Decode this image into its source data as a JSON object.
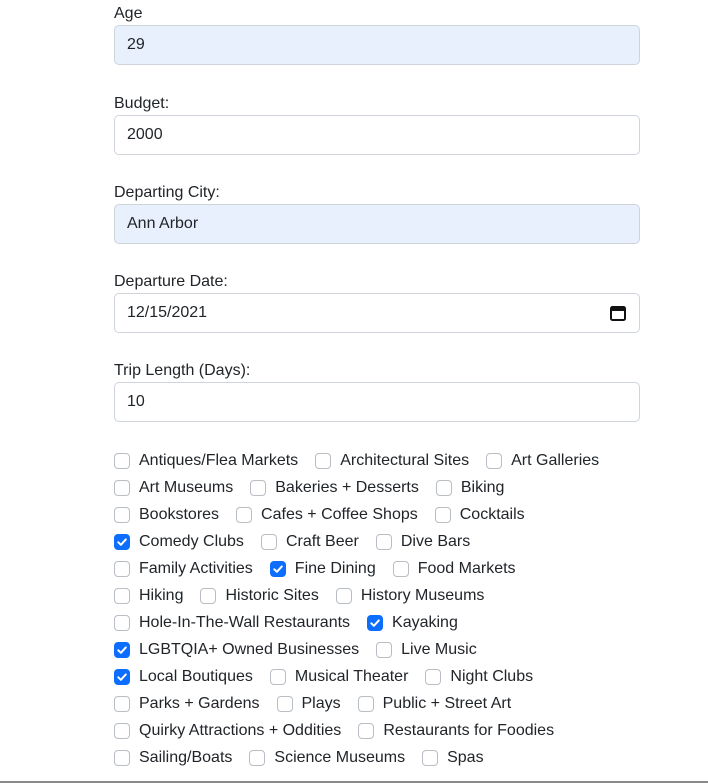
{
  "fields": {
    "age": {
      "label": "Age",
      "value": "29"
    },
    "budget": {
      "label": "Budget:",
      "value": "2000"
    },
    "departing_city": {
      "label": "Departing City:",
      "value": "Ann Arbor"
    },
    "departure_date": {
      "label": "Departure Date:",
      "value": "12/15/2021"
    },
    "trip_length": {
      "label": "Trip Length (Days):",
      "value": "10"
    }
  },
  "interests": {
    "rows": [
      [
        {
          "label": "Antiques/Flea Markets",
          "checked": false
        },
        {
          "label": "Architectural Sites",
          "checked": false
        },
        {
          "label": "Art Galleries",
          "checked": false
        }
      ],
      [
        {
          "label": "Art Museums",
          "checked": false
        },
        {
          "label": "Bakeries + Desserts",
          "checked": false
        },
        {
          "label": "Biking",
          "checked": false
        }
      ],
      [
        {
          "label": "Bookstores",
          "checked": false
        },
        {
          "label": "Cafes + Coffee Shops",
          "checked": false
        },
        {
          "label": "Cocktails",
          "checked": false
        }
      ],
      [
        {
          "label": "Comedy Clubs",
          "checked": true
        },
        {
          "label": "Craft Beer",
          "checked": false
        },
        {
          "label": "Dive Bars",
          "checked": false
        }
      ],
      [
        {
          "label": "Family Activities",
          "checked": false
        },
        {
          "label": "Fine Dining",
          "checked": true
        },
        {
          "label": "Food Markets",
          "checked": false
        }
      ],
      [
        {
          "label": "Hiking",
          "checked": false
        },
        {
          "label": "Historic Sites",
          "checked": false
        },
        {
          "label": "History Museums",
          "checked": false
        }
      ],
      [
        {
          "label": "Hole-In-The-Wall Restaurants",
          "checked": false
        },
        {
          "label": "Kayaking",
          "checked": true
        }
      ],
      [
        {
          "label": "LGBTQIA+ Owned Businesses",
          "checked": true
        },
        {
          "label": "Live Music",
          "checked": false
        }
      ],
      [
        {
          "label": "Local Boutiques",
          "checked": true
        },
        {
          "label": "Musical Theater",
          "checked": false
        },
        {
          "label": "Night Clubs",
          "checked": false
        }
      ],
      [
        {
          "label": "Parks + Gardens",
          "checked": false
        },
        {
          "label": "Plays",
          "checked": false
        },
        {
          "label": "Public + Street Art",
          "checked": false
        }
      ],
      [
        {
          "label": "Quirky Attractions + Oddities",
          "checked": false
        },
        {
          "label": "Restaurants for Foodies",
          "checked": false
        }
      ],
      [
        {
          "label": "Sailing/Boats",
          "checked": false
        },
        {
          "label": "Science Museums",
          "checked": false
        },
        {
          "label": "Spas",
          "checked": false
        }
      ]
    ]
  },
  "colors": {
    "checked": "#0d6efd",
    "autofill": "#e8f0fe",
    "border": "#ced4da"
  },
  "icons": {
    "calendar": "calendar-icon",
    "checkmark": "checkmark-icon"
  }
}
